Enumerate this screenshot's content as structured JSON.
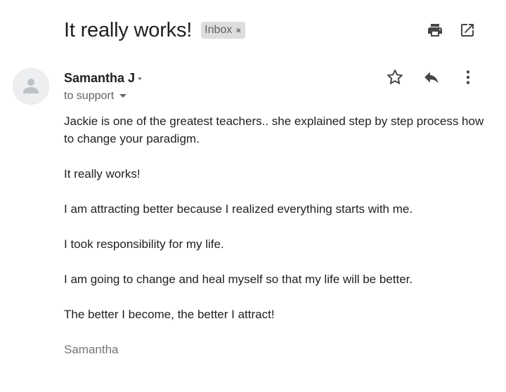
{
  "email": {
    "subject": "It really works!",
    "label": "Inbox",
    "label_remove": "×",
    "sender_name": "Samantha J",
    "recipient_line": "to support",
    "body_paragraphs": [
      "Jackie is one of the greatest teachers.. she explained step by step process how to change your paradigm.",
      "It really works!",
      "I am attracting better because I realized everything starts with me.",
      "I took responsibility for my life.",
      "I am going to change and heal myself so that my life will be better.",
      "The better I become, the better I attract!"
    ],
    "signature": "Samantha"
  },
  "icons": {
    "print": "print-icon",
    "open_new_window": "open-in-new-window-icon",
    "star": "star-icon",
    "reply": "reply-icon",
    "more": "more-vertical-icon",
    "avatar": "default-avatar-icon",
    "sender_caret": "caret-left-icon",
    "recipient_caret": "chevron-down-icon"
  },
  "colors": {
    "text_primary": "#202124",
    "text_secondary": "#5f6368",
    "signature": "#757575",
    "label_chip_bg": "#dddddd",
    "avatar_bg": "#eceef0"
  }
}
